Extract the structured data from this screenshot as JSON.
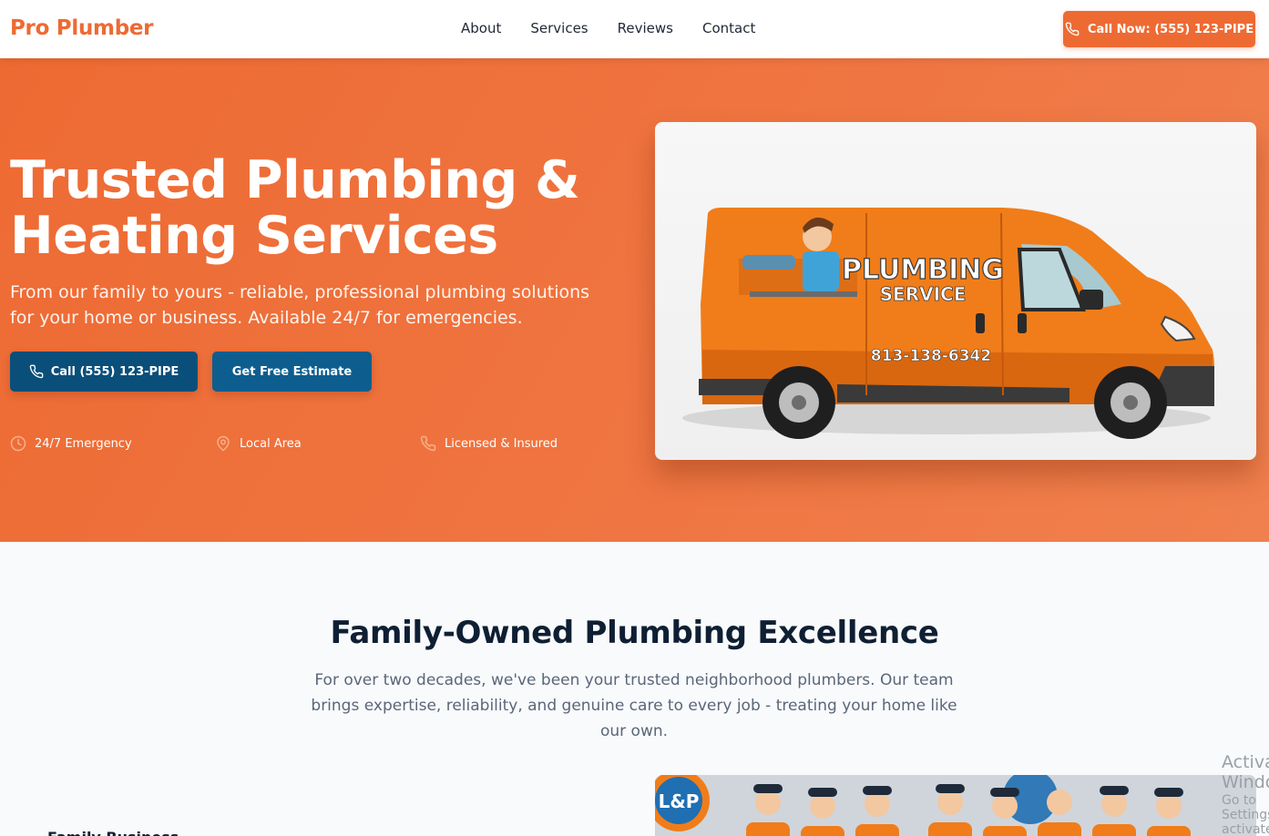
{
  "brand": {
    "name": "Pro Plumber",
    "accent": "#ee6a33",
    "dark_blue": "#0a4f7a"
  },
  "nav": {
    "items": [
      "About",
      "Services",
      "Reviews",
      "Contact"
    ]
  },
  "header": {
    "call_label": "Call Now: (555) 123-PIPE",
    "call_icon": "phone-icon"
  },
  "hero": {
    "title_line1": "Trusted Plumbing &",
    "title_line2": "Heating Services",
    "subtitle": "From our family to yours - reliable, professional plumbing solutions for your home or business. Available 24/7 for emergencies.",
    "call_button": "Call (555) 123-PIPE",
    "estimate_button": "Get Free Estimate",
    "features": [
      {
        "label": "24/7 Emergency",
        "icon": "clock-icon"
      },
      {
        "label": "Local Area",
        "icon": "map-pin-icon"
      },
      {
        "label": "Licensed & Insured",
        "icon": "phone-icon"
      }
    ],
    "van": {
      "text1": "PLUMBING",
      "text2": "SERVICE",
      "phone": "813-138-6342"
    }
  },
  "about": {
    "title": "Family-Owned Plumbing Excellence",
    "text": "For over two decades, we've been your trusted neighborhood plumbers. Our team brings expertise, reliability, and genuine care to every job - treating your home like our own.",
    "sub_label": "Family Business",
    "team_logo": "L&P"
  },
  "watermark": {
    "line1": "Activate Windows",
    "line2": "Go to Settings to activate Windows."
  }
}
